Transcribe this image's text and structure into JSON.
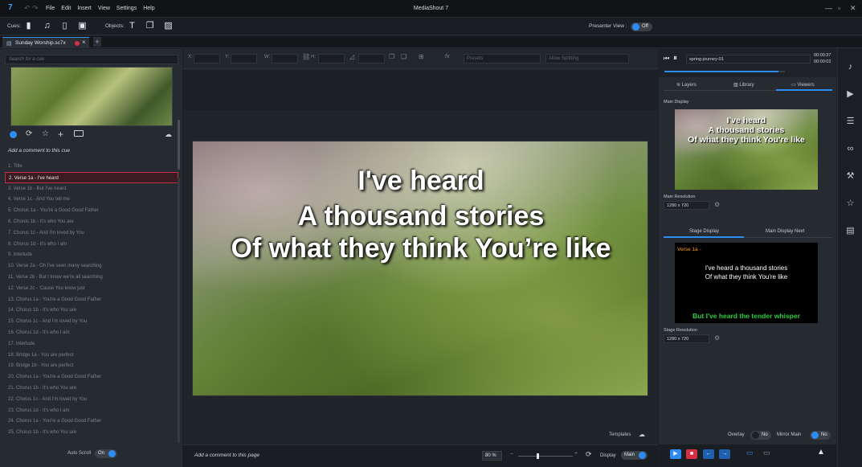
{
  "app": {
    "title": "MediaShout 7",
    "logo": "7"
  },
  "menu": [
    "File",
    "Edit",
    "Insert",
    "View",
    "Settings",
    "Help"
  ],
  "toolbar": {
    "cues_label": "Cues:",
    "objects_label": "Objects:",
    "presenter_view_label": "Presenter View :",
    "presenter_view_state": "Off"
  },
  "tab": {
    "name": "Sunday Worship.sc7x",
    "close": "×",
    "add": "+"
  },
  "left": {
    "search_placeholder": "Search for a cue",
    "comment": "Add a comment to this cue",
    "cues": [
      "1. Title",
      "2. Verse 1a - I've heard",
      "3. Verse 1b - But I've heard",
      "4. Verse 1c - And You tell me",
      "5. Chorus 1a - You're a Good Good Father",
      "6. Chorus 1b - It's who You are",
      "7. Chorus 1c - And I'm loved by You",
      "8. Chorus 1d - It's who I am",
      "9. Interlude",
      "10. Verse 2a - Oh I've seen many searching",
      "11. Verse 2b - But I know we're all searching",
      "12. Verse 2c - 'Cause You know just",
      "13. Chorus 1a - You're a Good Good Father",
      "14. Chorus 1b - It's who You are",
      "15. Chorus 1c - And I'm loved by You",
      "16. Chorus 1d - It's who I am",
      "17. Interlude",
      "18. Bridge 1a - You are perfect",
      "19. Bridge 1b - You are perfect",
      "20. Chorus 1a - You're a Good Good Father",
      "21. Chorus 1b - It's who You are",
      "22. Chorus 1c - And I'm loved by You",
      "23. Chorus 1d - It's who I am",
      "24. Chorus 1a - You're a Good Good Father",
      "25. Chorus 1b - It's who You are"
    ],
    "selected_index": 1,
    "auto_scroll_label": "Auto Scroll",
    "auto_scroll_state": "On"
  },
  "props": {
    "x": "X:",
    "y": "Y:",
    "w": "W:",
    "h": "H:",
    "presets_placeholder": "Presets",
    "splitting_placeholder": "Allow Splitting"
  },
  "slide": {
    "line1": "I've heard",
    "line2": "A thousand stories",
    "line3": "Of what they think You’re like"
  },
  "center_bottom": {
    "templates_label": "Templates",
    "comment": "Add a comment to this page",
    "zoom": "80 %",
    "display_label": "Display",
    "display_value": "Main"
  },
  "player": {
    "track": "spring-journey-01",
    "time_elapsed": "00:00:37",
    "time_remaining": "00:00:02"
  },
  "right_tabs": {
    "layers": "Layers",
    "library": "Library",
    "viewers": "Viewers"
  },
  "main_display": {
    "label": "Main Display",
    "line1": "I've heard",
    "line2": "A thousand stories",
    "line3": "Of what they think You're like",
    "resolution_label": "Main Resolution",
    "resolution": "1280 x 720"
  },
  "stage_tabs": {
    "stage": "Stage Display",
    "next": "Main Display Next"
  },
  "stage_display": {
    "cue_name": "Verse 1a -",
    "line1": "I've heard a thousand stories",
    "line2": "Of what they think You're like",
    "next_line": "But I've heard the tender whisper",
    "resolution_label": "Stage Resolution",
    "resolution": "1280 x 720"
  },
  "right_bottom": {
    "overlay_label": "Overlay",
    "overlay_state": "No",
    "mirror_label": "Mirror Main",
    "mirror_state": "No"
  },
  "colors": {
    "accent": "#2d8cf0",
    "stop": "#d63040",
    "selection": "#c23045",
    "stage_next": "#2ecc40"
  }
}
